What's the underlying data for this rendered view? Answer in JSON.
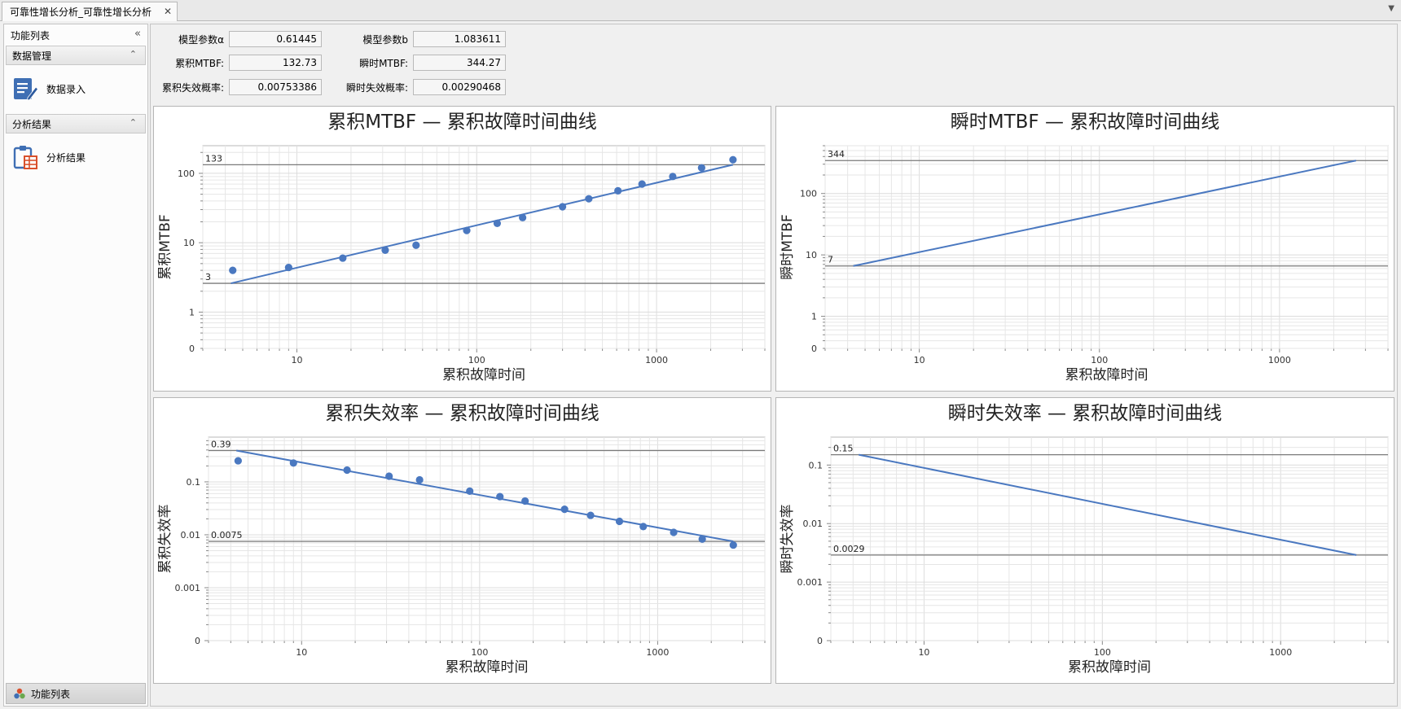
{
  "tab": {
    "title": "可靠性增长分析_可靠性增长分析",
    "close_glyph": "✕",
    "dropdown_glyph": "▼"
  },
  "sidebar": {
    "title": "功能列表",
    "collapse_glyph": "«",
    "groups": [
      {
        "label": "数据管理",
        "chevron": "⌃",
        "items": [
          {
            "label": "数据录入",
            "icon": "data-entry-icon"
          }
        ]
      },
      {
        "label": "分析结果",
        "chevron": "⌃",
        "items": [
          {
            "label": "分析结果",
            "icon": "analysis-result-icon"
          }
        ]
      }
    ],
    "footer_label": "功能列表"
  },
  "params": [
    {
      "label": "模型参数α",
      "value": "0.61445"
    },
    {
      "label": "模型参数b",
      "value": "1.083611"
    },
    {
      "label": "累积MTBF:",
      "value": "132.73"
    },
    {
      "label": "瞬时MTBF:",
      "value": "344.27"
    },
    {
      "label": "累积失效概率:",
      "value": "0.00753386"
    },
    {
      "label": "瞬时失效概率:",
      "value": "0.00290468"
    }
  ],
  "colors": {
    "series": "#4a78c0",
    "refline": "#7a7a7a",
    "grid": "#e6e6e6"
  },
  "chart_data": [
    {
      "type": "scatter",
      "title": "累积MTBF — 累积故障时间曲线",
      "xlabel": "累积故障时间",
      "ylabel": "累积MTBF",
      "x_scale": "log",
      "y_scale": "log",
      "xlim": [
        3,
        4000
      ],
      "ylim": [
        0.3,
        250
      ],
      "x_ticks": [
        10,
        100,
        1000
      ],
      "y_ticks": [
        0,
        1,
        10,
        100
      ],
      "points": [
        [
          4.4,
          4
        ],
        [
          9,
          4.4
        ],
        [
          18,
          6
        ],
        [
          31,
          7.8
        ],
        [
          46,
          9.2
        ],
        [
          88,
          15
        ],
        [
          130,
          19
        ],
        [
          180,
          23
        ],
        [
          300,
          33
        ],
        [
          420,
          43
        ],
        [
          610,
          56
        ],
        [
          830,
          70
        ],
        [
          1230,
          90
        ],
        [
          1780,
          120
        ],
        [
          2660,
          157
        ]
      ],
      "fit_line": [
        [
          4.3,
          2.6
        ],
        [
          2660,
          133
        ]
      ],
      "ref_lines": [
        {
          "y": 133,
          "label": "133"
        },
        {
          "y": 2.6,
          "label": "3"
        }
      ],
      "grid": true
    },
    {
      "type": "line",
      "title": "瞬时MTBF — 累积故障时间曲线",
      "xlabel": "累积故障时间",
      "ylabel": "瞬时MTBF",
      "x_scale": "log",
      "y_scale": "log",
      "xlim": [
        3,
        4000
      ],
      "ylim": [
        0.3,
        600
      ],
      "x_ticks": [
        10,
        100,
        1000
      ],
      "y_ticks": [
        0,
        1,
        10,
        100
      ],
      "points": [],
      "fit_line": [
        [
          4.3,
          6.6
        ],
        [
          2660,
          344
        ]
      ],
      "ref_lines": [
        {
          "y": 344,
          "label": "344"
        },
        {
          "y": 6.6,
          "label": "7"
        }
      ],
      "grid": true
    },
    {
      "type": "scatter",
      "title": "累积失效率 — 累积故障时间曲线",
      "xlabel": "累积故障时间",
      "ylabel": "累积失效率",
      "x_scale": "log",
      "y_scale": "log",
      "xlim": [
        3,
        4000
      ],
      "ylim": [
        0.0001,
        0.7
      ],
      "x_ticks": [
        10,
        100,
        1000
      ],
      "y_ticks": [
        0,
        0.001,
        0.01,
        0.1
      ],
      "points": [
        [
          4.4,
          0.25
        ],
        [
          9,
          0.227
        ],
        [
          18,
          0.167
        ],
        [
          31,
          0.128
        ],
        [
          46,
          0.109
        ],
        [
          88,
          0.0667
        ],
        [
          130,
          0.0526
        ],
        [
          180,
          0.0435
        ],
        [
          300,
          0.0303
        ],
        [
          420,
          0.0233
        ],
        [
          610,
          0.0179
        ],
        [
          830,
          0.0143
        ],
        [
          1230,
          0.0111
        ],
        [
          1780,
          0.0083
        ],
        [
          2660,
          0.0064
        ]
      ],
      "fit_line": [
        [
          4.3,
          0.39
        ],
        [
          2660,
          0.0075
        ]
      ],
      "ref_lines": [
        {
          "y": 0.39,
          "label": "0.39"
        },
        {
          "y": 0.0075,
          "label": "0.0075"
        }
      ],
      "grid": true
    },
    {
      "type": "line",
      "title": "瞬时失效率 — 累积故障时间曲线",
      "xlabel": "累积故障时间",
      "ylabel": "瞬时失效率",
      "x_scale": "log",
      "y_scale": "log",
      "xlim": [
        3,
        4000
      ],
      "ylim": [
        0.0001,
        0.3
      ],
      "x_ticks": [
        10,
        100,
        1000
      ],
      "y_ticks": [
        0,
        0.001,
        0.01,
        0.1
      ],
      "points": [],
      "fit_line": [
        [
          4.3,
          0.15
        ],
        [
          2660,
          0.0029
        ]
      ],
      "ref_lines": [
        {
          "y": 0.15,
          "label": "0.15"
        },
        {
          "y": 0.0029,
          "label": "0.0029"
        }
      ],
      "grid": true
    }
  ]
}
